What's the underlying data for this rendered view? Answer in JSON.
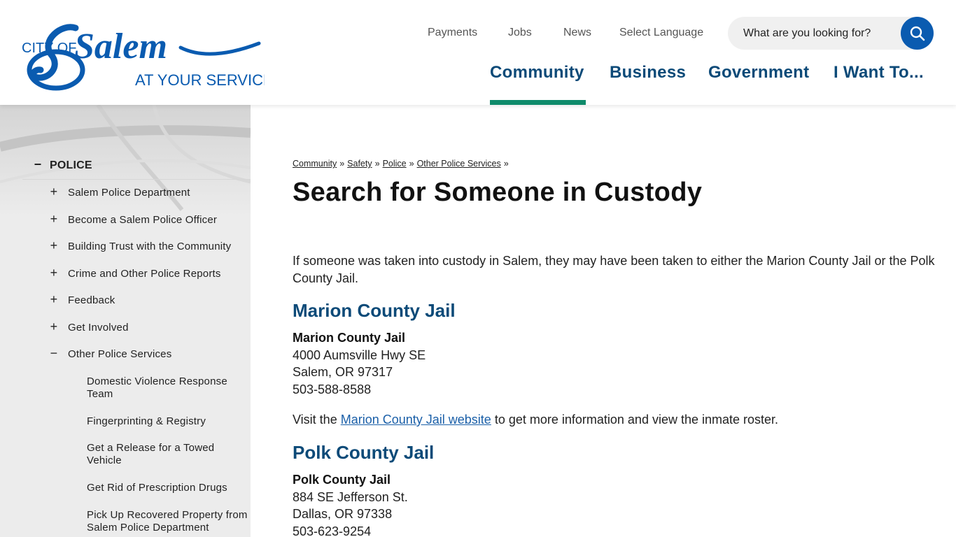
{
  "header": {
    "logo": {
      "line1": "CITY OF",
      "wordmark": "Salem",
      "tagline": "AT YOUR SERVICE"
    },
    "utility_links": [
      "Payments",
      "Jobs",
      "News",
      "Select Language"
    ],
    "search": {
      "placeholder": "What are you looking for?",
      "icon": "search-icon"
    },
    "main_nav": [
      "Community",
      "Business",
      "Government",
      "I Want To..."
    ],
    "active_nav": "Community"
  },
  "sidebar": {
    "section": {
      "symbol": "−",
      "label": "POLICE"
    },
    "items": [
      {
        "symbol": "+",
        "label": "Salem Police Department"
      },
      {
        "symbol": "+",
        "label": "Become a Salem Police Officer"
      },
      {
        "symbol": "+",
        "label": "Building Trust with the Community"
      },
      {
        "symbol": "+",
        "label": "Crime and Other Police Reports"
      },
      {
        "symbol": "+",
        "label": "Feedback"
      },
      {
        "symbol": "+",
        "label": "Get Involved"
      },
      {
        "symbol": "−",
        "label": "Other Police Services"
      }
    ],
    "subitems": [
      "Domestic Violence Response Team",
      "Fingerprinting & Registry",
      "Get a Release for a Towed Vehicle",
      "Get Rid of Prescription Drugs",
      "Pick Up Recovered Property from Salem Police Department"
    ]
  },
  "main": {
    "breadcrumb": [
      "Community",
      "Safety",
      "Police",
      "Other Police Services"
    ],
    "breadcrumb_sep": "»",
    "title": "Search for Someone in Custody",
    "intro": "If someone was taken into custody in Salem, they may have been taken to either the Marion County Jail or the Polk County Jail.",
    "marion": {
      "heading": "Marion County Jail",
      "name": "Marion County Jail",
      "street": "4000 Aumsville Hwy SE",
      "city": "Salem, OR 97317",
      "phone": "503-588-8588",
      "visit_before": "Visit the ",
      "visit_link": "Marion County Jail website",
      "visit_after": " to get more information and view the inmate roster."
    },
    "polk": {
      "heading": "Polk County Jail",
      "name": "Polk County Jail",
      "street": "884 SE Jefferson St.",
      "city": "Dallas, OR 97338",
      "phone": "503-623-9254"
    }
  },
  "colors": {
    "brand_blue": "#0c4a78",
    "accent_green": "#0e8a6a",
    "search_button": "#0a5bb0",
    "link": "#1a5fa8"
  }
}
